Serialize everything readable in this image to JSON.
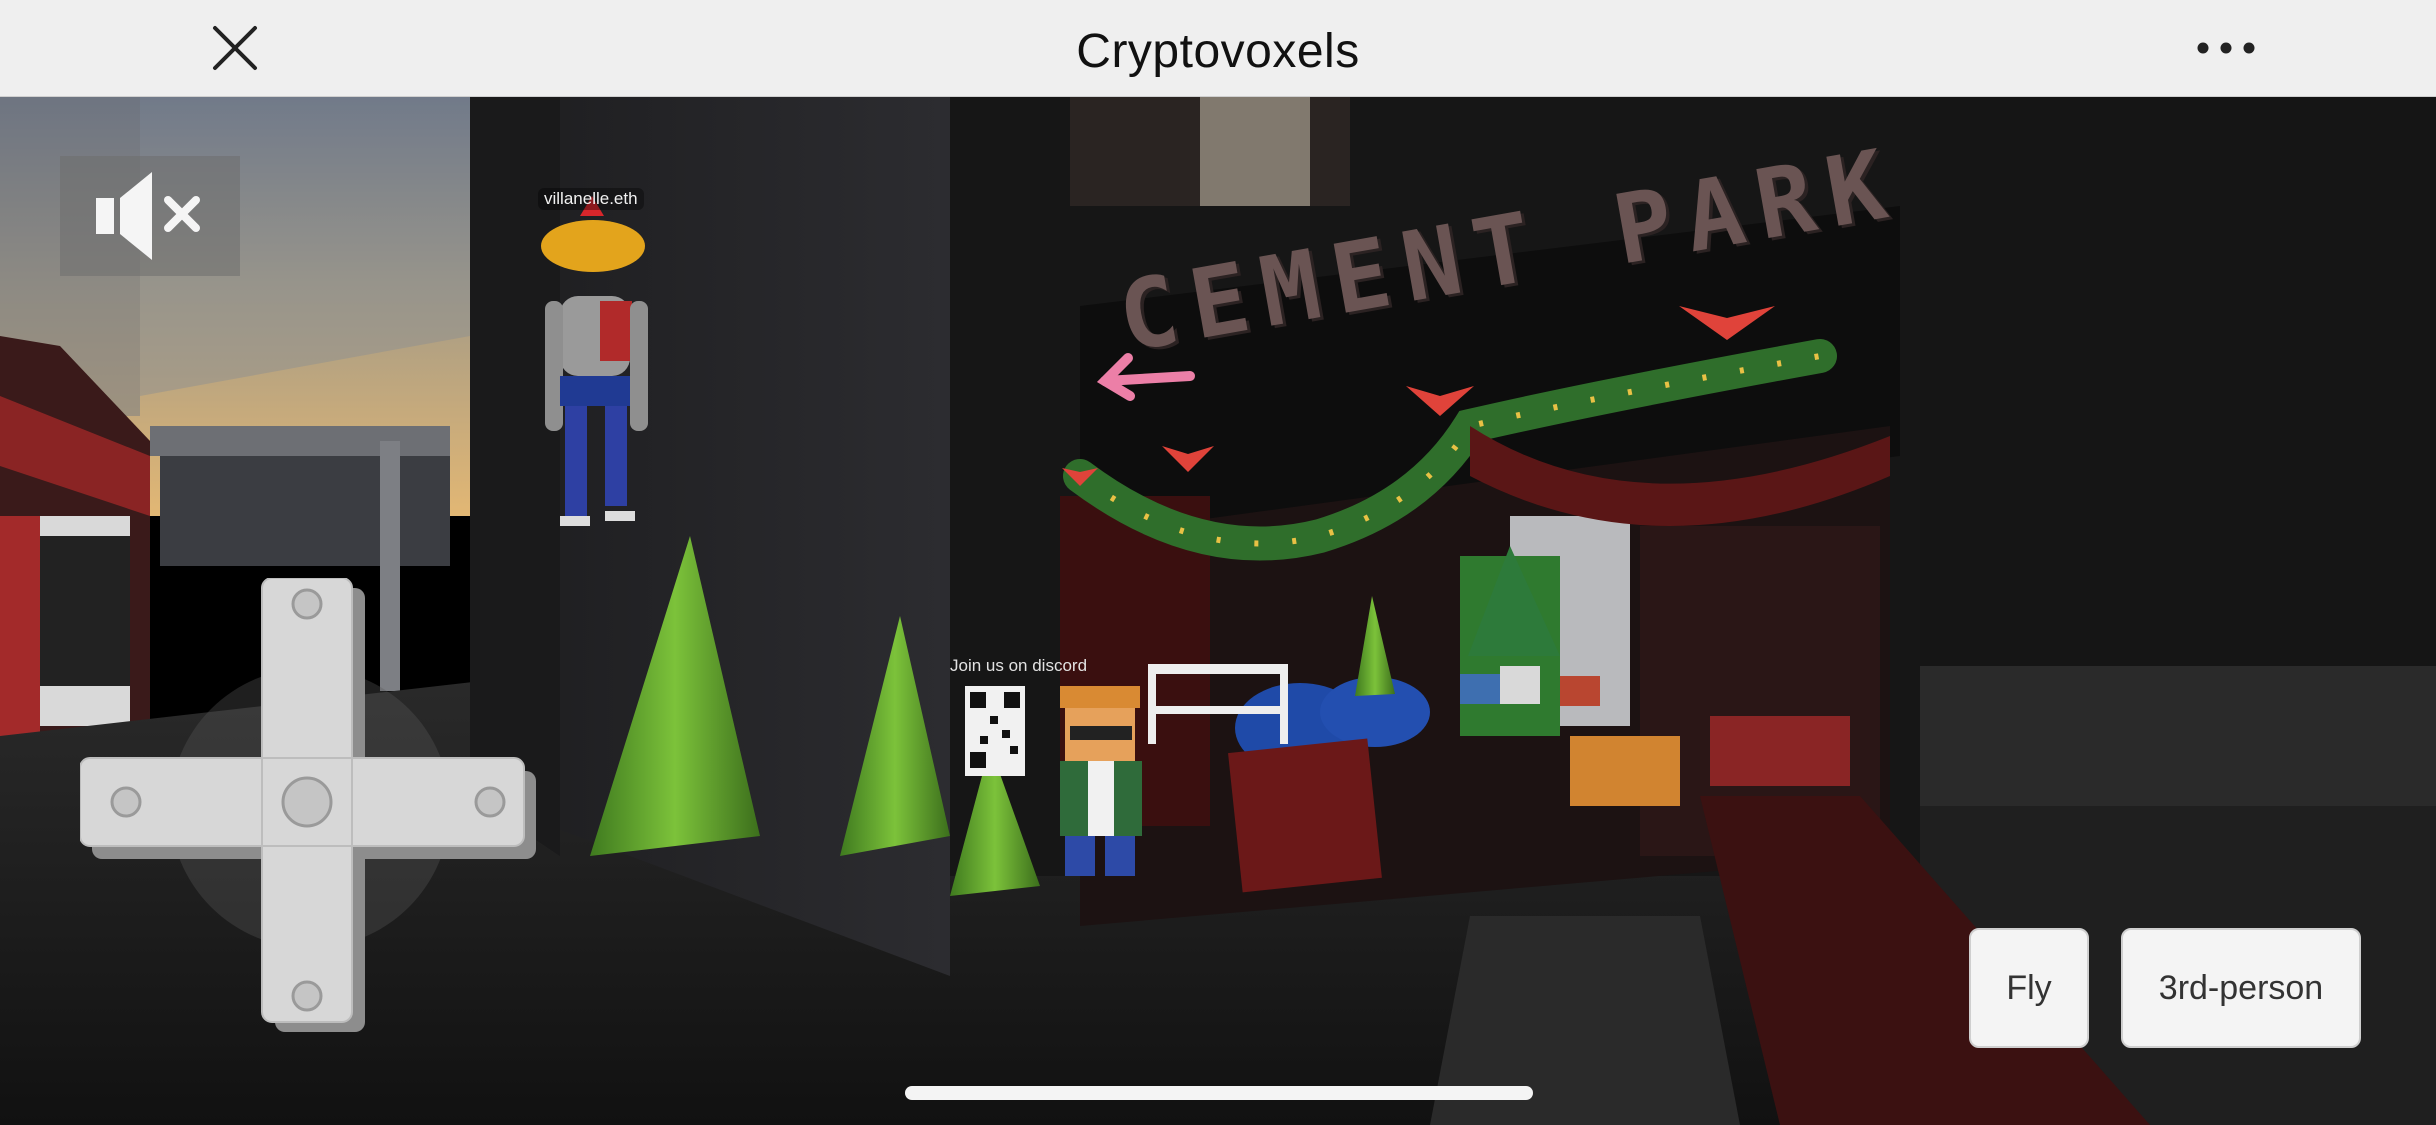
{
  "navbar": {
    "title": "Cryptovoxels",
    "close_icon": "close-icon",
    "more_icon": "more-horizontal-icon"
  },
  "controls": {
    "mute_icon": "speaker-muted-icon",
    "dpad_icon": "dpad-icon",
    "fly_label": "Fly",
    "third_person_label": "3rd-person"
  },
  "scene": {
    "avatar_name": "villanelle.eth",
    "discord_sign": "Join us on discord",
    "park_sign": "CEMENT PARK"
  },
  "colors": {
    "navbar_bg": "#efefef",
    "button_bg": "#f4f4f4",
    "sky_top": "#6f7890",
    "sky_horizon": "#d9b77a"
  }
}
